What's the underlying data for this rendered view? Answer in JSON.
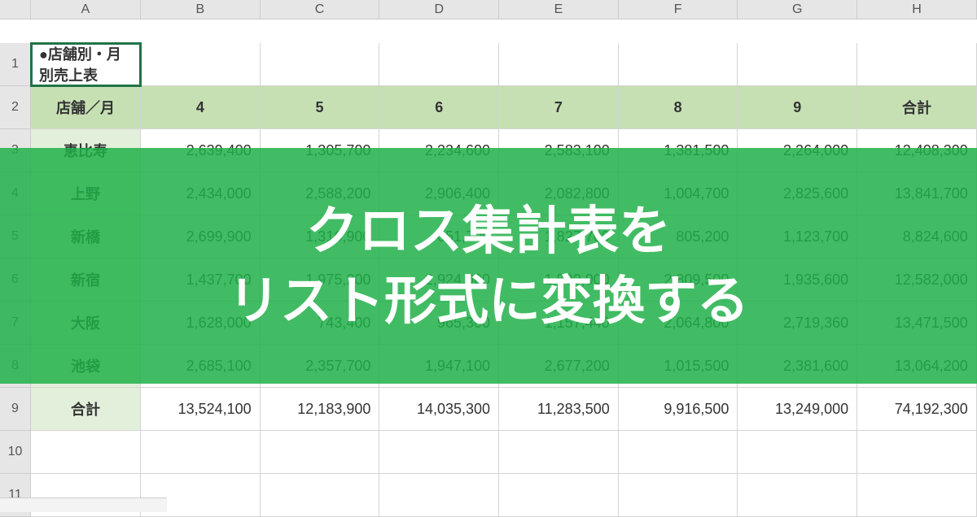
{
  "colHeaders": [
    "A",
    "B",
    "C",
    "D",
    "E",
    "F",
    "G",
    "H"
  ],
  "rowHeaders": [
    "1",
    "2",
    "3",
    "4",
    "5",
    "6",
    "7",
    "8",
    "9",
    "10",
    "11"
  ],
  "title": "●店舗別・月別売上表",
  "headerRow": [
    "店舗／月",
    "4",
    "5",
    "6",
    "7",
    "8",
    "9",
    "合計"
  ],
  "rows": [
    {
      "label": "恵比寿",
      "vals": [
        "2,639,400",
        "1,305,700",
        "2,234,600",
        "2,583,100",
        "1,381,500",
        "2,264,000",
        "12,408,300"
      ]
    },
    {
      "label": "上野",
      "vals": [
        "2,434,000",
        "2,588,200",
        "2,906,400",
        "2,082,800",
        "1,004,700",
        "2,825,600",
        "13,841,700"
      ]
    },
    {
      "label": "新橋",
      "vals": [
        "2,699,900",
        "1,316,900",
        "051,700",
        "1,827,700",
        "805,200",
        "1,123,700",
        "8,824,600"
      ]
    },
    {
      "label": "新宿",
      "vals": [
        "1,437,700",
        "1,975,200",
        "2,924,000",
        "1,500,000",
        "2,809,500",
        "1,935,600",
        "12,582,000"
      ]
    },
    {
      "label": "大阪",
      "vals": [
        "1,628,000",
        "743,400",
        "965,300",
        "1,157,440",
        "2,064,800",
        "2,719,360",
        "13,471,500"
      ]
    },
    {
      "label": "池袋",
      "vals": [
        "2,685,100",
        "2,357,700",
        "1,947,100",
        "2,677,200",
        "1,015,500",
        "2,381,600",
        "13,064,200"
      ]
    },
    {
      "label": "合計",
      "vals": [
        "13,524,100",
        "12,183,900",
        "14,035,300",
        "11,283,500",
        "9,916,500",
        "13,249,000",
        "74,192,300"
      ]
    }
  ],
  "overlay": {
    "line1": "クロス集計表を",
    "line2": "リスト形式に変換する"
  }
}
